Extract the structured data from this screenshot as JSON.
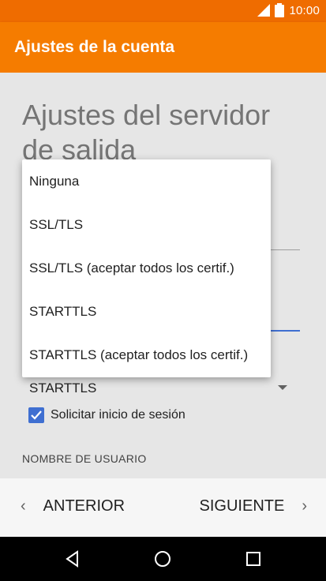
{
  "status_bar": {
    "time": "10:00",
    "icons": [
      "signal-icon",
      "battery-icon"
    ]
  },
  "app_bar": {
    "title": "Ajustes de la cuenta"
  },
  "page": {
    "heading": "Ajustes del servidor de salida"
  },
  "security": {
    "selected": "STARTTLS",
    "options": [
      "Ninguna",
      "SSL/TLS",
      "SSL/TLS (aceptar todos los certif.)",
      "STARTTLS",
      "STARTTLS (aceptar todos los certif.)"
    ]
  },
  "require_signin": {
    "label": "Solicitar inicio de sesión",
    "checked": true
  },
  "username_section": {
    "label": "NOMBRE DE USUARIO"
  },
  "navigation": {
    "prev_label": "ANTERIOR",
    "next_label": "SIGUIENTE"
  },
  "colors": {
    "accent": "#f57c00",
    "status": "#ef6c00",
    "checkbox": "#3f6fd1"
  }
}
